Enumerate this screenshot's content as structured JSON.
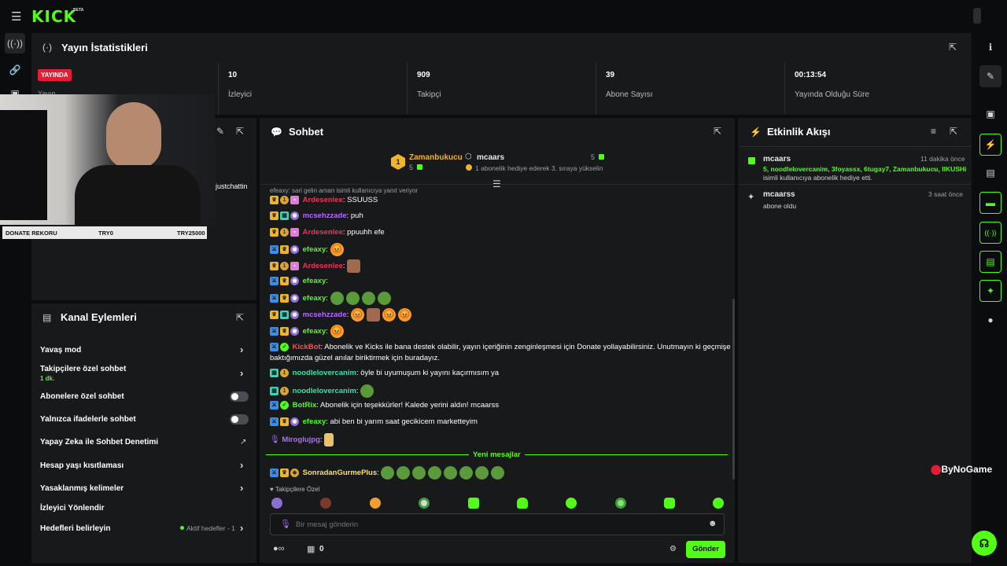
{
  "brand": {
    "logo": "KICK",
    "beta": "BETA"
  },
  "stats": {
    "title": "Yayın İstatistikleri",
    "live_badge": "YAYINDA",
    "live_sub": "Yayın",
    "items": [
      {
        "value": "10",
        "label": "İzleyici"
      },
      {
        "value": "909",
        "label": "Takipçi"
      },
      {
        "value": "39",
        "label": "Abone Sayısı"
      },
      {
        "value": "00:13:54",
        "label": "Yayında Olduğu Süre"
      }
    ]
  },
  "webcam": {
    "donate_label": "DONATE REKORU",
    "donate_try": "TRY0",
    "donate_max": "TRY25000",
    "side_text": "justchattin"
  },
  "actions": {
    "title": "Kanal Eylemleri",
    "rows": [
      {
        "label": "Yavaş mod"
      },
      {
        "label": "Takipçilere özel sohbet",
        "sub": "1 dk."
      },
      {
        "label": "Abonelere özel sohbet"
      },
      {
        "label": "Yalnızca ifadelerle sohbet"
      },
      {
        "label": "Yapay Zeka ile Sohbet Denetimi"
      },
      {
        "label": "Hesap yaşı kısıtlaması"
      },
      {
        "label": "Yasaklanmış kelimeler"
      },
      {
        "label": "İzleyici Yönlendir"
      },
      {
        "label": "Hedefleri belirleyin",
        "status": "Aktif hedefler - 1"
      }
    ]
  },
  "chat": {
    "title": "Sohbet",
    "leaderboard": {
      "rank": "1",
      "top_user": "Zamanbukucu",
      "top_count": "5",
      "gift_user": "mcaars",
      "gift_count": "5",
      "gift_text": "1 abonelik hediye ederek 3. sıraya yükselin"
    },
    "reply_note": "efeaxy: sari gelin aman isimli kullanıcıya yanıt veriyor",
    "messages": [
      {
        "user": "Ardesenlee",
        "text": ": SSUUSS"
      },
      {
        "user": "mcsehzzade",
        "text": ": puh"
      },
      {
        "user": "Ardesenlee",
        "text": ": ppuuhh efe"
      },
      {
        "user": "efeaxy",
        "text": ":"
      },
      {
        "user": "Ardesenlee",
        "text": ":"
      },
      {
        "user": "efeaxy",
        "text": ":"
      },
      {
        "user": "efeaxy",
        "text": ":"
      },
      {
        "user": "mcsehzzade",
        "text": ":"
      },
      {
        "user": "efeaxy",
        "text": ":"
      },
      {
        "user": "KickBot",
        "text": ": Abonelik ve Kicks ile bana destek olabilir, yayın içeriğinin zenginleşmesi için Donate yollayabilirsiniz. Unutmayın ki geçmişe",
        "text2": "baktığımızda güzel anılar biriktirmek için buradayız."
      },
      {
        "user": "noodlelovercanim",
        "text": ": öyle bi uyumuşum ki yayını kaçırmısım ya"
      },
      {
        "user": "noodlelovercanim",
        "text": ":"
      },
      {
        "user": "BotRix",
        "text": ": Abonelik için teşekkürler! Kalede yerini aldın! mcaarss"
      },
      {
        "user": "efeaxy",
        "text": ": abi ben bi yarım saat gecikicem marketteyim"
      },
      {
        "user": "Miroglujpg",
        "text": ":"
      }
    ],
    "new_messages": "Yeni mesajlar",
    "last_message": {
      "user": "SonradanGurmePlus",
      "text": ":"
    },
    "followers_only": "Takipçilere Özel",
    "input_placeholder": "Bir mesaj gönderin",
    "kicks_count": "0",
    "send_label": "Gönder"
  },
  "activity": {
    "title": "Etkinlik Akışı",
    "items": [
      {
        "user": "mcaars",
        "time": "11 dakika önce",
        "highlight": "5, noodlelovercanim, 3foyassx, 6tugay7, Zamanbukucu, IlKUSHi",
        "text": "isimli kullanıcıya abonelik hediye etti."
      },
      {
        "user": "mcaarss",
        "time": "3 saat önce",
        "text": "abone oldu"
      }
    ]
  },
  "watermark": "ByNoGame",
  "colors": {
    "accent": "#53fc18",
    "live": "#e51c35",
    "panel": "#18191b"
  }
}
